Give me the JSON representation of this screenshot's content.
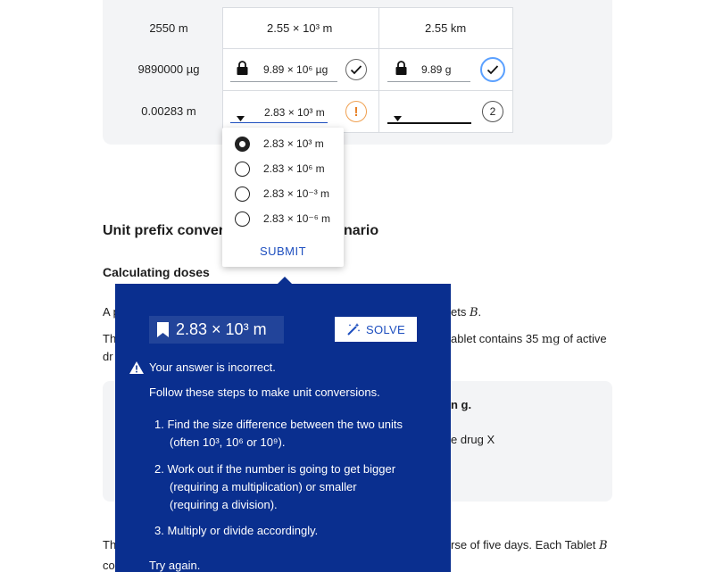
{
  "table": {
    "rows": [
      {
        "given": "2550 m",
        "answer1": "2.55 × 10³ m",
        "answer2": "2.55 km"
      },
      {
        "given": "9890000 µg",
        "answer1": "9.89 × 10⁶ µg",
        "answer2": "9.89 g"
      },
      {
        "given": "0.00283 m",
        "answer1": "2.83 × 10³ m",
        "answer2": "",
        "attempts": "2",
        "warn": "!"
      }
    ]
  },
  "dropdown": {
    "options": [
      "2.83 × 10³ m",
      "2.83 × 10⁶ m",
      "2.83 × 10⁻³ m",
      "2.83 × 10⁻⁶ m"
    ],
    "selected_index": 0,
    "submit_label": "SUBMIT"
  },
  "content": {
    "heading_left": "Unit prefix conver",
    "heading_right": "nario",
    "subheading": "Calculating doses",
    "line_a_left": "A p",
    "line_a_right_prefix": "ets ",
    "line_a_right_var": "B",
    "line_a_right_suffix": ".",
    "line_th_left": "Th",
    "line_th_right_prefix": "ablet contains 35 ",
    "line_th_right_unit": "mg",
    "line_th_right_suffix": " of active",
    "line_dr_left": "dr",
    "card_line1_right": "n g.",
    "card_line2_right": "e drug X",
    "bottom_left1": "Th",
    "bottom_right1_prefix": "rse of five days. Each Tablet ",
    "bottom_right1_var": "B",
    "bottom_left2": "co"
  },
  "feedback": {
    "answer": "2.83 × 10³ m",
    "solve_label": "SOLVE",
    "incorrect": "Your answer is incorrect.",
    "intro": "Follow these steps to make unit conversions.",
    "step1_a": "1. Find the size difference between the two units",
    "step1_b": "(often 10³, 10⁶ or 10⁹).",
    "step2_a": "2. Work out if the number is going to get bigger",
    "step2_b": "(requiring a multiplication) or smaller",
    "step2_c": "(requiring a division).",
    "step3": "3. Multiply or divide accordingly.",
    "try_again": "Try again."
  },
  "colors": {
    "popup_bg": "#0a2f8f",
    "accent_blue": "#1e4fbf",
    "warning": "#e67e22",
    "panel_bg": "#f3f4f6"
  },
  "icons": {
    "lock": "lock-icon",
    "check": "check-icon",
    "warning": "warning-icon",
    "dropdown": "caret-down-icon",
    "bookmark": "bookmark-icon",
    "solve": "magic-wand-icon"
  }
}
